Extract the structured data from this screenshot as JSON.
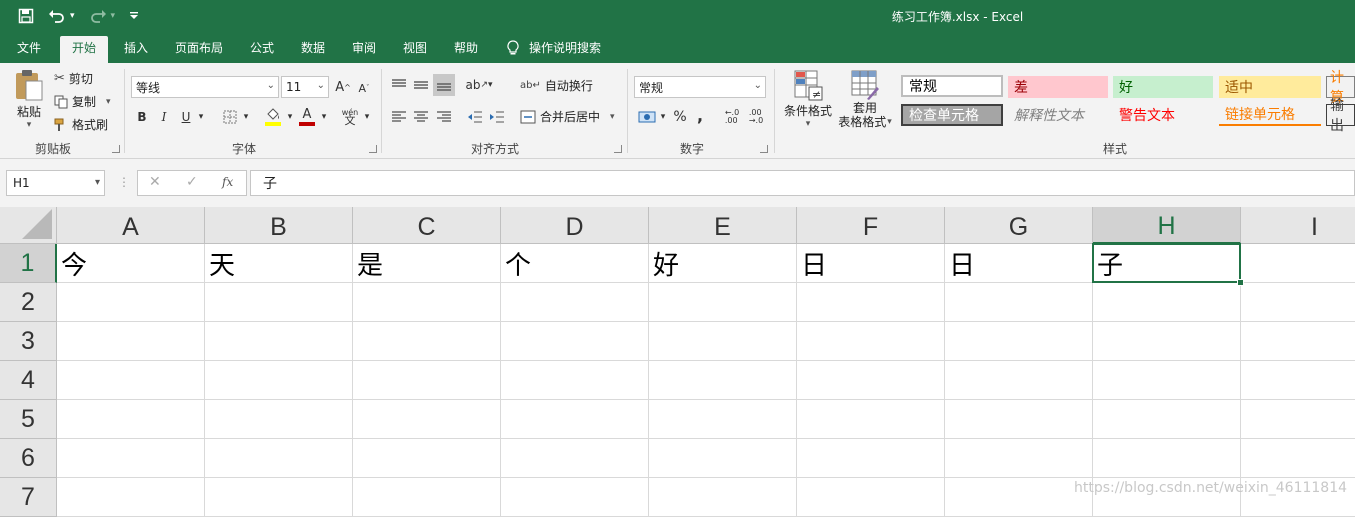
{
  "window": {
    "title": "练习工作簿.xlsx  -  Excel"
  },
  "qat": {
    "save_icon": "save-icon",
    "undo_icon": "undo-icon",
    "redo_icon": "redo-icon",
    "customize_icon": "chevron-down-icon"
  },
  "tabs": [
    "文件",
    "开始",
    "插入",
    "页面布局",
    "公式",
    "数据",
    "审阅",
    "视图",
    "帮助"
  ],
  "tell_me": "操作说明搜索",
  "ribbon": {
    "clipboard": {
      "paste": "粘贴",
      "cut": "剪切",
      "copy": "复制",
      "format_painter": "格式刷",
      "label": "剪贴板"
    },
    "font": {
      "name": "等线",
      "size": "11",
      "label": "字体",
      "font_color": "#c00000",
      "highlight_color": "#ffff00"
    },
    "alignment": {
      "wrap": "自动换行",
      "merge": "合并后居中",
      "label": "对齐方式"
    },
    "number": {
      "format": "常规",
      "label": "数字"
    },
    "styles": {
      "conditional": "条件格式",
      "table_line1": "套用",
      "table_line2": "表格格式",
      "label": "样式",
      "gallery": [
        {
          "text": "常规",
          "bg": "#ffffff",
          "color": "#000000"
        },
        {
          "text": "差",
          "bg": "#ffc7ce",
          "color": "#9c0006"
        },
        {
          "text": "好",
          "bg": "#c6efce",
          "color": "#006100"
        },
        {
          "text": "适中",
          "bg": "#ffeb9c",
          "color": "#9c5700"
        },
        {
          "text": "计算",
          "bg": "#f2f2f2",
          "color": "#fa7d00"
        },
        {
          "text": "检查单元格",
          "bg": "#a5a5a5",
          "color": "#ffffff"
        },
        {
          "text": "解释性文本",
          "bg": "#f3f3f3",
          "color": "#7f7f7f"
        },
        {
          "text": "警告文本",
          "bg": "#f3f3f3",
          "color": "#ff0000"
        },
        {
          "text": "链接单元格",
          "bg": "#f3f3f3",
          "color": "#fa7d00"
        },
        {
          "text": "输出",
          "bg": "#f2f2f2",
          "color": "#3f3f3f"
        }
      ]
    }
  },
  "formula_bar": {
    "name_box": "H1",
    "cancel": "✕",
    "enter": "✓",
    "fx": "fx",
    "content": "子"
  },
  "sheet": {
    "columns": [
      "A",
      "B",
      "C",
      "D",
      "E",
      "F",
      "G",
      "H",
      "I"
    ],
    "rows": [
      "1",
      "2",
      "3",
      "4",
      "5",
      "6",
      "7"
    ],
    "row1": [
      "今",
      "天",
      "是",
      "个",
      "好",
      "日",
      "日",
      "子",
      ""
    ],
    "selected_col": "H",
    "selected_row": "1"
  },
  "watermark": "https://blog.csdn.net/weixin_46111814",
  "accent_color": "#217346"
}
